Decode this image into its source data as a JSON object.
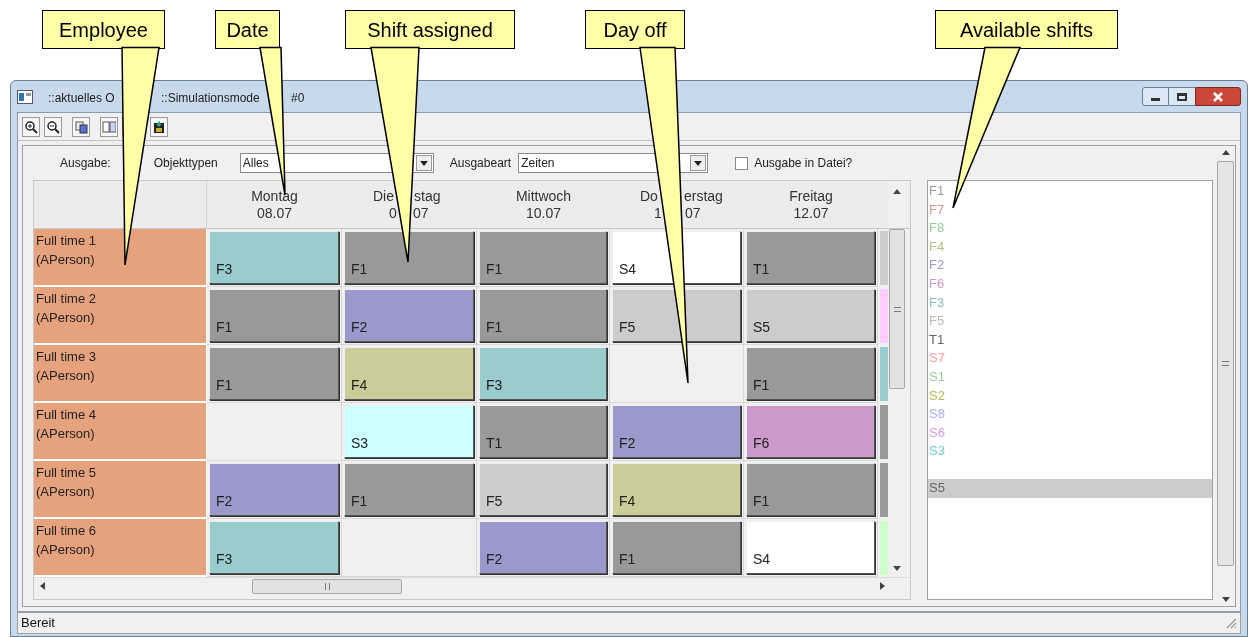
{
  "callouts": [
    {
      "label": "Employee"
    },
    {
      "label": "Date"
    },
    {
      "label": "Shift assigned"
    },
    {
      "label": "Day off"
    },
    {
      "label": "Available shifts"
    }
  ],
  "window": {
    "title_parts": [
      "::aktuelles O",
      "::Simulationsmode",
      "#0"
    ]
  },
  "options": {
    "output_label": "Ausgabe:",
    "object_types_label": "Objekttypen",
    "object_types_value": "Alles",
    "output_kind_label": "Ausgabeart",
    "output_kind_value": "Zeiten",
    "to_file": {
      "label": "Ausgabe in Datei?",
      "checked": false
    }
  },
  "days": [
    {
      "name_parts": [
        "Montag"
      ],
      "date_parts": [
        "08.07"
      ]
    },
    {
      "name_parts": [
        "Die",
        "stag"
      ],
      "date_parts": [
        "0",
        "07"
      ]
    },
    {
      "name_parts": [
        "Mittwoch"
      ],
      "date_parts": [
        "10.07"
      ]
    },
    {
      "name_parts": [
        "Do",
        "erstag"
      ],
      "date_parts": [
        "1",
        "07"
      ]
    },
    {
      "name_parts": [
        "Freitag"
      ],
      "date_parts": [
        "12.07"
      ]
    }
  ],
  "employees": [
    {
      "name": "Full time 1",
      "type": "(APerson)",
      "shifts": [
        {
          "kind": "shift",
          "label": "F3",
          "color": "#99cccc"
        },
        {
          "kind": "shift",
          "label": "F1",
          "color": "#999999"
        },
        {
          "kind": "shift",
          "label": "F1",
          "color": "#999999"
        },
        {
          "kind": "shift",
          "label": "S4",
          "color": "#ffffff"
        },
        {
          "kind": "shift",
          "label": "T1",
          "color": "#999999"
        },
        {
          "kind": "partial",
          "color": "#cccccc"
        }
      ]
    },
    {
      "name": "Full time 2",
      "type": "(APerson)",
      "shifts": [
        {
          "kind": "shift",
          "label": "F1",
          "color": "#999999"
        },
        {
          "kind": "shift",
          "label": "F2",
          "color": "#9999cc"
        },
        {
          "kind": "shift",
          "label": "F1",
          "color": "#999999"
        },
        {
          "kind": "shift",
          "label": "F5",
          "color": "#cccccc"
        },
        {
          "kind": "shift",
          "label": "S5",
          "color": "#cccccc"
        },
        {
          "kind": "partial",
          "color": "#ffccff"
        }
      ]
    },
    {
      "name": "Full time 3",
      "type": "(APerson)",
      "shifts": [
        {
          "kind": "shift",
          "label": "F1",
          "color": "#999999"
        },
        {
          "kind": "shift",
          "label": "F4",
          "color": "#cccc99"
        },
        {
          "kind": "shift",
          "label": "F3",
          "color": "#99cccc"
        },
        {
          "kind": "day_off"
        },
        {
          "kind": "shift",
          "label": "F1",
          "color": "#999999"
        },
        {
          "kind": "partial",
          "color": "#99cccc"
        }
      ]
    },
    {
      "name": "Full time 4",
      "type": "(APerson)",
      "shifts": [
        {
          "kind": "day_off"
        },
        {
          "kind": "shift",
          "label": "S3",
          "color": "#ccffff"
        },
        {
          "kind": "shift",
          "label": "T1",
          "color": "#999999"
        },
        {
          "kind": "shift",
          "label": "F2",
          "color": "#9999cc"
        },
        {
          "kind": "shift",
          "label": "F6",
          "color": "#cc99cc"
        },
        {
          "kind": "partial",
          "color": "#999999"
        }
      ]
    },
    {
      "name": "Full time 5",
      "type": "(APerson)",
      "shifts": [
        {
          "kind": "shift",
          "label": "F2",
          "color": "#9999cc"
        },
        {
          "kind": "shift",
          "label": "F1",
          "color": "#999999"
        },
        {
          "kind": "shift",
          "label": "F5",
          "color": "#cccccc"
        },
        {
          "kind": "shift",
          "label": "F4",
          "color": "#cccc99"
        },
        {
          "kind": "shift",
          "label": "F1",
          "color": "#999999"
        },
        {
          "kind": "partial",
          "color": "#999999"
        }
      ]
    },
    {
      "name": "Full time 6",
      "type": "(APerson)",
      "shifts": [
        {
          "kind": "shift",
          "label": "F3",
          "color": "#99cccc"
        },
        {
          "kind": "day_off"
        },
        {
          "kind": "shift",
          "label": "F2",
          "color": "#9999cc"
        },
        {
          "kind": "shift",
          "label": "F1",
          "color": "#999999"
        },
        {
          "kind": "shift",
          "label": "S4",
          "color": "#ffffff"
        },
        {
          "kind": "partial",
          "color": "#ccffcc"
        }
      ]
    }
  ],
  "available_shifts": [
    {
      "label": "F1",
      "color": "#999999",
      "selected": false
    },
    {
      "label": "F7",
      "color": "#cc9999",
      "selected": false
    },
    {
      "label": "F8",
      "color": "#99cc99",
      "selected": false
    },
    {
      "label": "F4",
      "color": "#bbbb88",
      "selected": false
    },
    {
      "label": "F2",
      "color": "#9999cc",
      "selected": false
    },
    {
      "label": "F6",
      "color": "#cc99cc",
      "selected": false
    },
    {
      "label": "F3",
      "color": "#88bbbb",
      "selected": false
    },
    {
      "label": "F5",
      "color": "#bbbbbb",
      "selected": false
    },
    {
      "label": "T1",
      "color": "#666666",
      "selected": false
    },
    {
      "label": "S7",
      "color": "#ff9999",
      "selected": false
    },
    {
      "label": "S1",
      "color": "#99cc99",
      "selected": false
    },
    {
      "label": "S2",
      "color": "#b8b850",
      "selected": false
    },
    {
      "label": "S8",
      "color": "#aaaaee",
      "selected": false
    },
    {
      "label": "S6",
      "color": "#dd99dd",
      "selected": false
    },
    {
      "label": "S3",
      "color": "#77cccc",
      "selected": false
    },
    {
      "label": "S5",
      "color": "#666666",
      "selected": true
    }
  ],
  "status_bar": "Bereit"
}
